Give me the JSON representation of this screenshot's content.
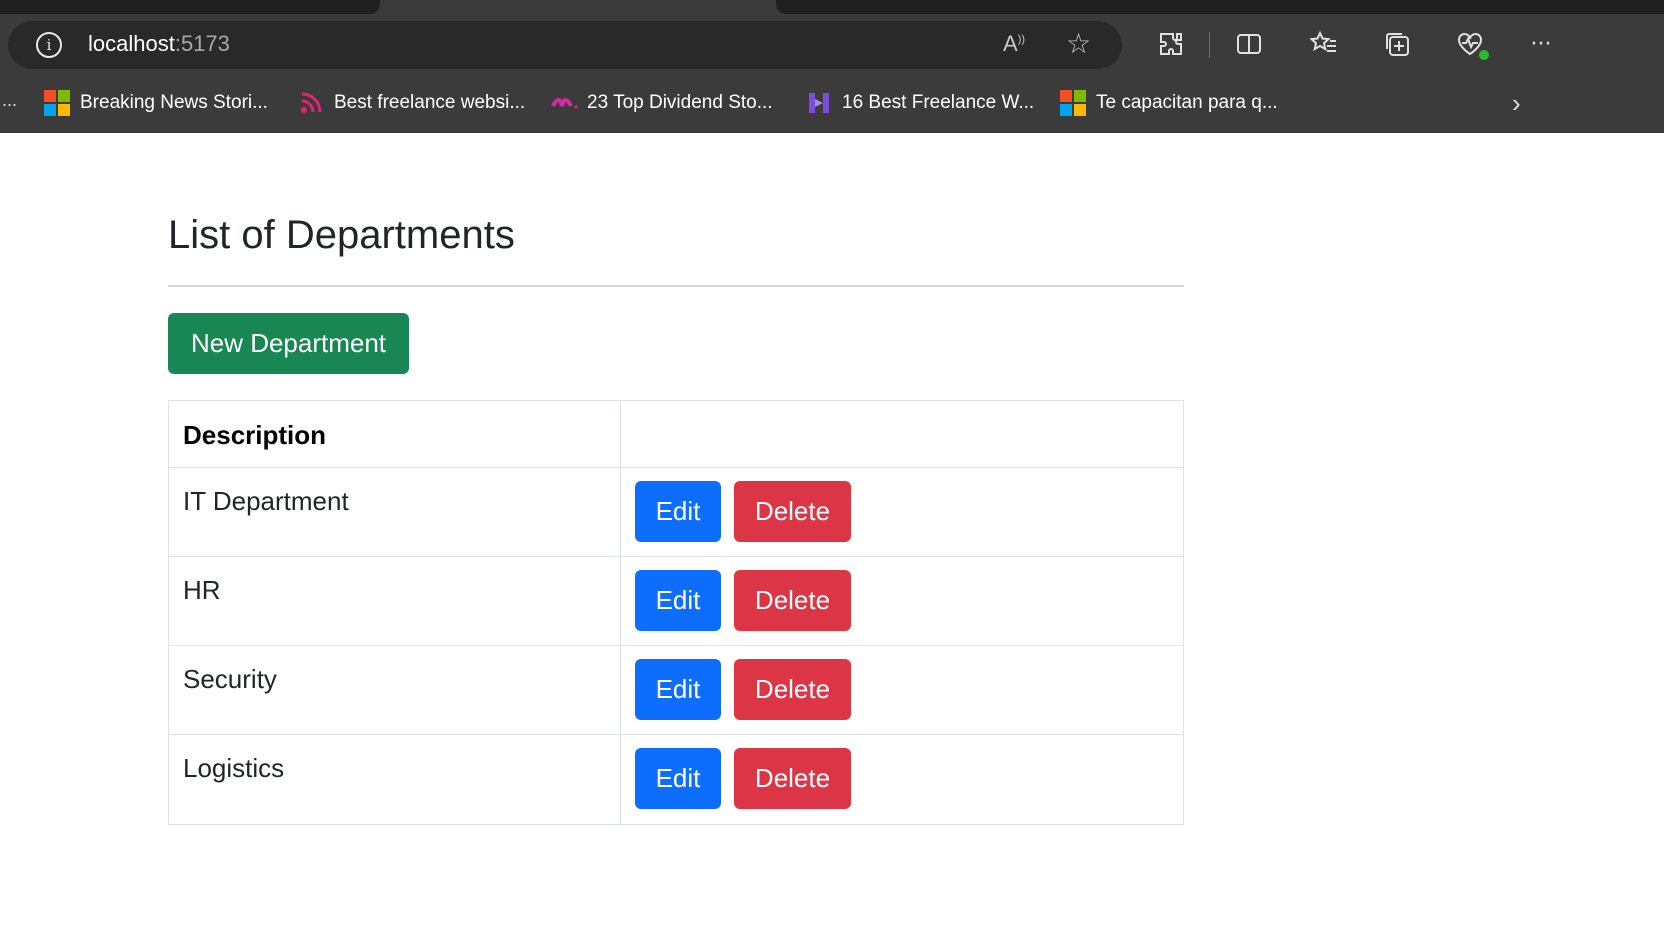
{
  "browser": {
    "url_host": "localhost",
    "url_port": ":5173",
    "favorites": [
      {
        "label": "Breaking News Stori...",
        "icon": "microsoft-icon"
      },
      {
        "label": "Best freelance websi...",
        "icon": "rss-icon"
      },
      {
        "label": "23 Top Dividend Sto...",
        "icon": "wave-logo-icon"
      },
      {
        "label": "16 Best Freelance W...",
        "icon": "h-logo-icon"
      },
      {
        "label": "Te capacitan para q...",
        "icon": "microsoft-icon"
      }
    ],
    "favorites_overflow": "...",
    "colors": {
      "chrome": "#3b3b3b",
      "addressbar": "#292929"
    }
  },
  "page": {
    "title": "List of Departments",
    "new_button": "New Department",
    "table": {
      "headers": [
        "Description",
        ""
      ],
      "rows": [
        {
          "description": "IT Department"
        },
        {
          "description": "HR"
        },
        {
          "description": "Security"
        },
        {
          "description": "Logistics"
        }
      ],
      "edit_label": "Edit",
      "delete_label": "Delete"
    },
    "colors": {
      "success": "#198754",
      "primary": "#0d6efd",
      "danger": "#dc3545"
    }
  }
}
